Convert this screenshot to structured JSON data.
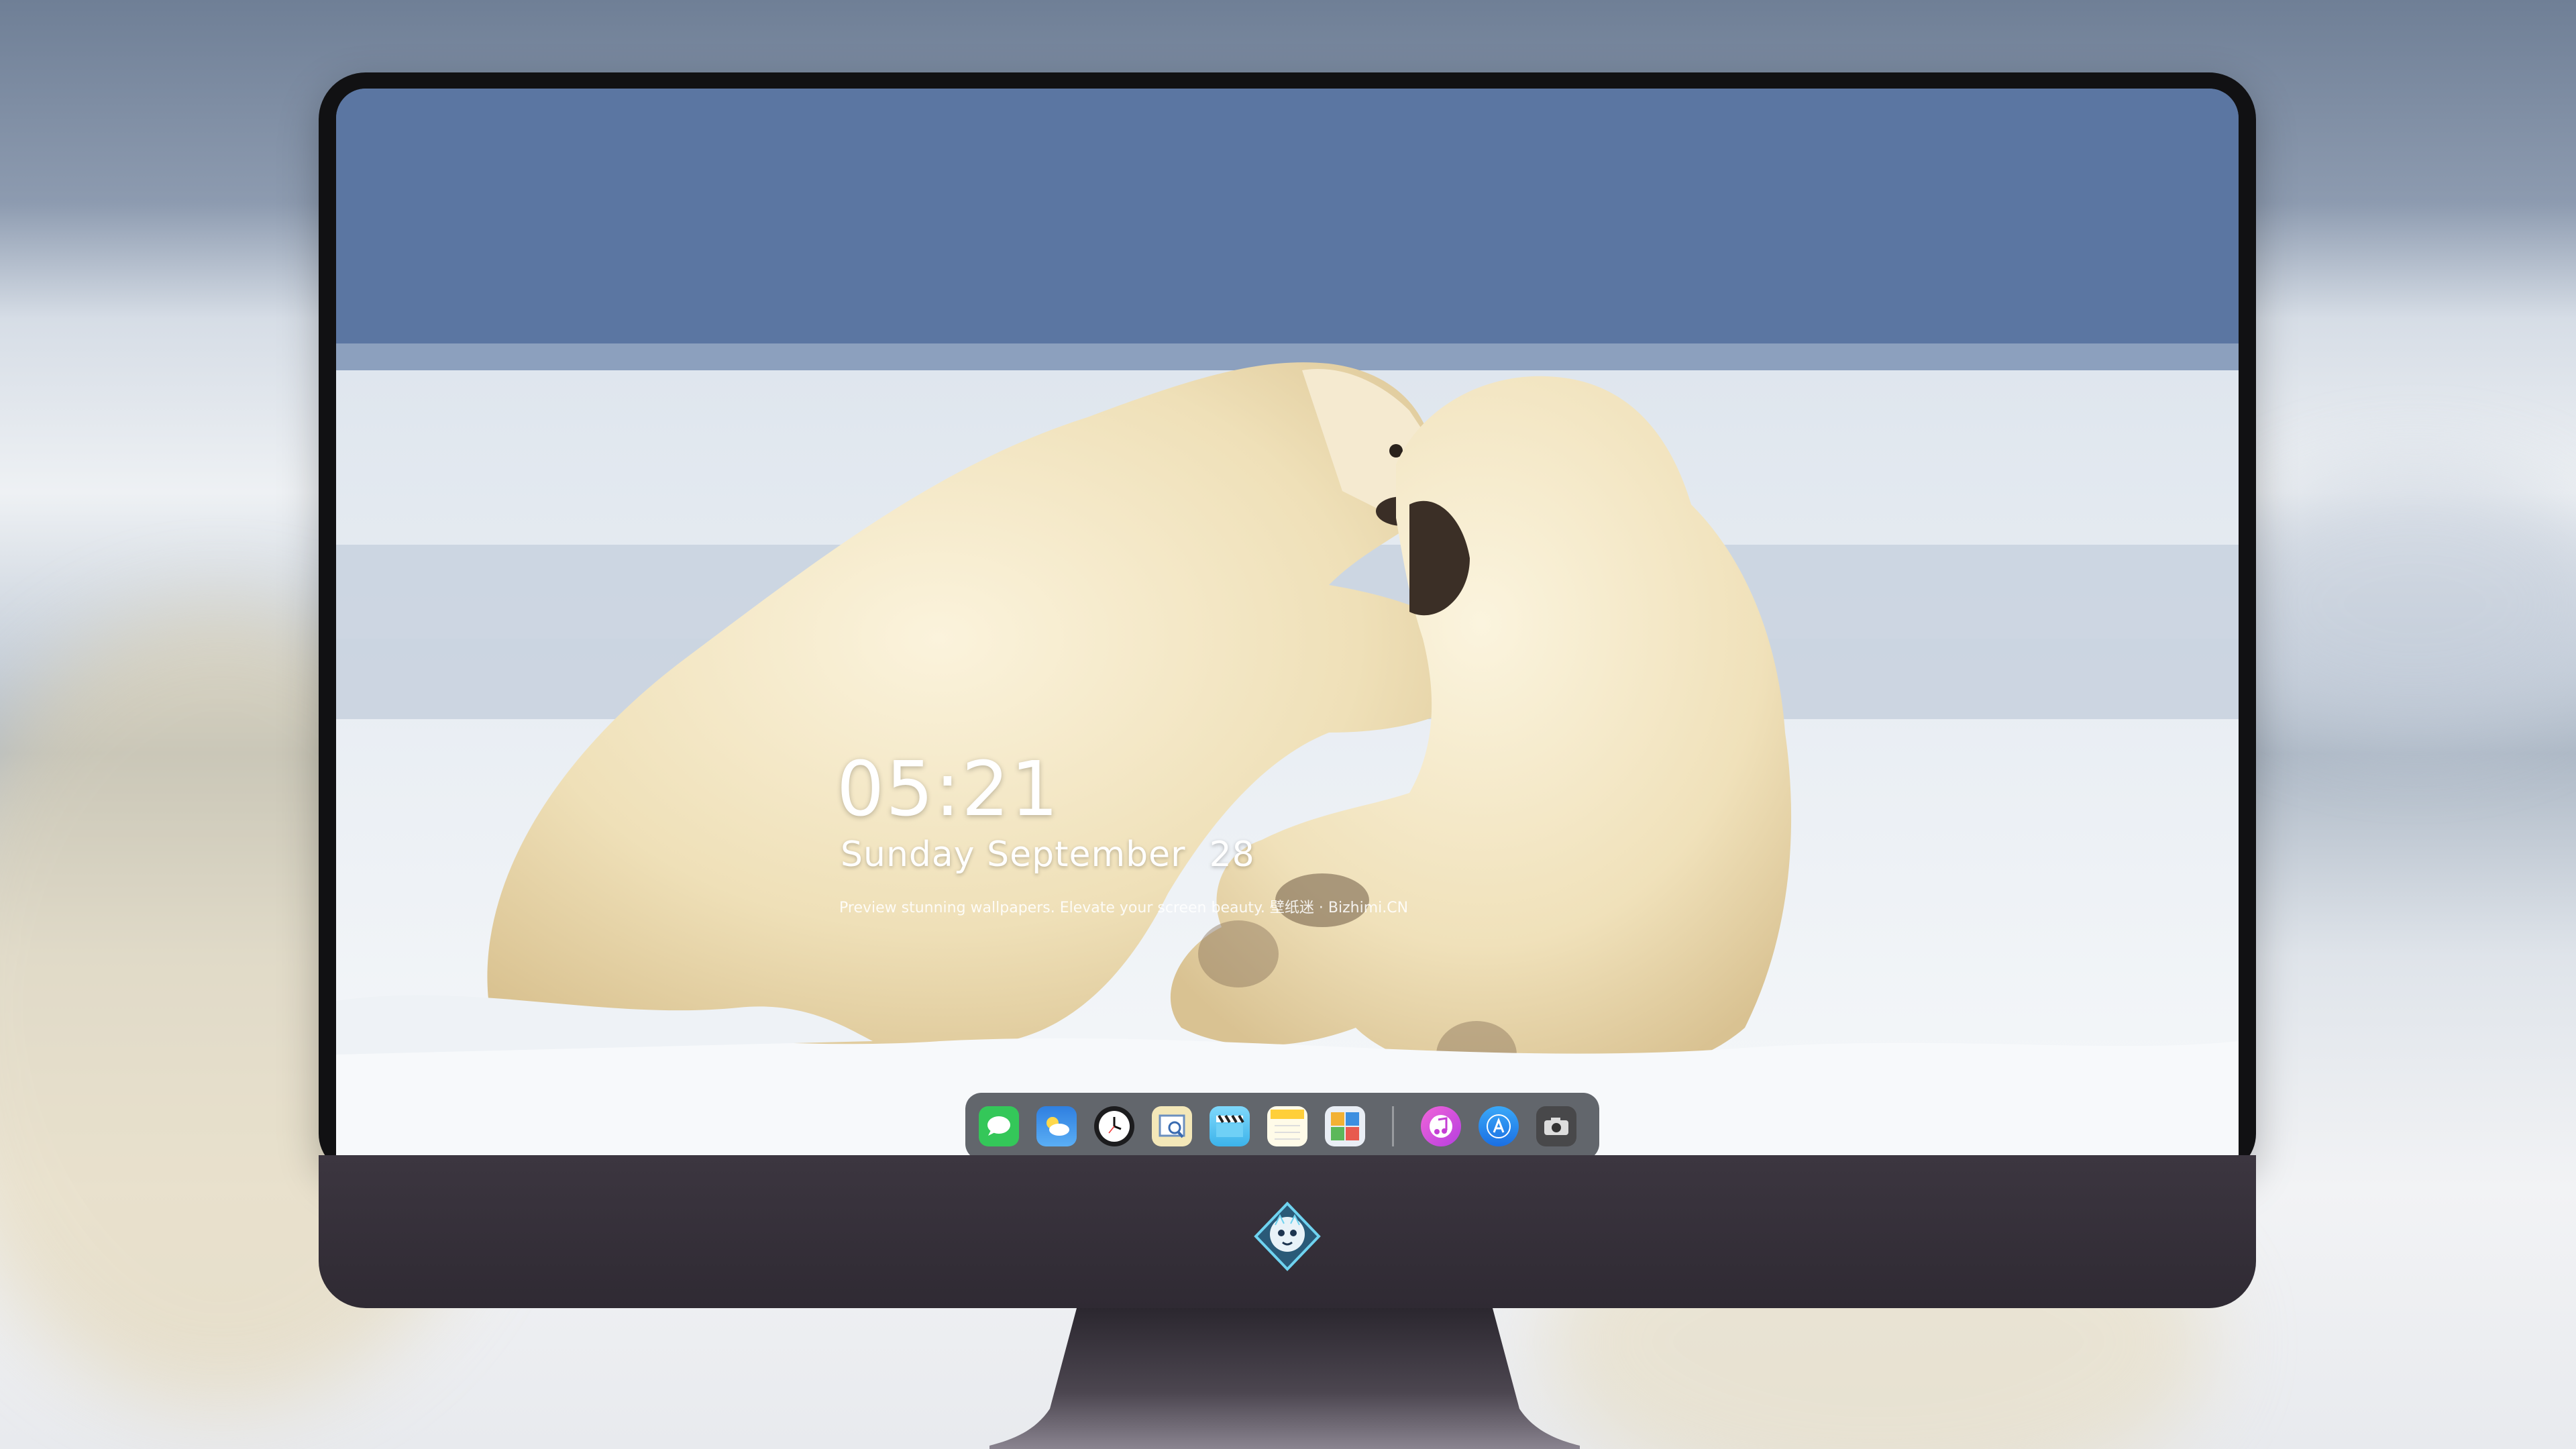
{
  "lock_screen": {
    "time": "05:21",
    "date": "Sunday September  28",
    "tagline": "Preview stunning wallpapers. Elevate your screen beauty. 壁纸迷 · Bizhimi.CN"
  },
  "dock": {
    "apps": [
      {
        "name": "Messages",
        "icon": "messages-icon",
        "color": "#34c759"
      },
      {
        "name": "Weather",
        "icon": "weather-icon",
        "color": "#3a8ee6"
      },
      {
        "name": "Clock",
        "icon": "clock-icon",
        "color": "#1c1c1e"
      },
      {
        "name": "Preview",
        "icon": "preview-icon",
        "color": "#e8d38a"
      },
      {
        "name": "Clips",
        "icon": "clips-icon",
        "color": "#5ac8fa"
      },
      {
        "name": "Notes",
        "icon": "notes-icon",
        "color": "#ffd54a"
      },
      {
        "name": "Photo Booth",
        "icon": "photobooth-icon",
        "color": "#2e8bd8"
      },
      {
        "name": "Music",
        "icon": "music-icon",
        "color": "#e04ec2"
      },
      {
        "name": "App Store",
        "icon": "appstore-icon",
        "color": "#1d8cf3"
      },
      {
        "name": "Camera",
        "icon": "camera-icon",
        "color": "#3a3a3c"
      }
    ]
  },
  "branding": {
    "logo": "bizhimi-logo"
  },
  "colors": {
    "monitor_chin": "#342e38",
    "dock_bg": "#2c3038",
    "sky": "#4d6a99"
  }
}
